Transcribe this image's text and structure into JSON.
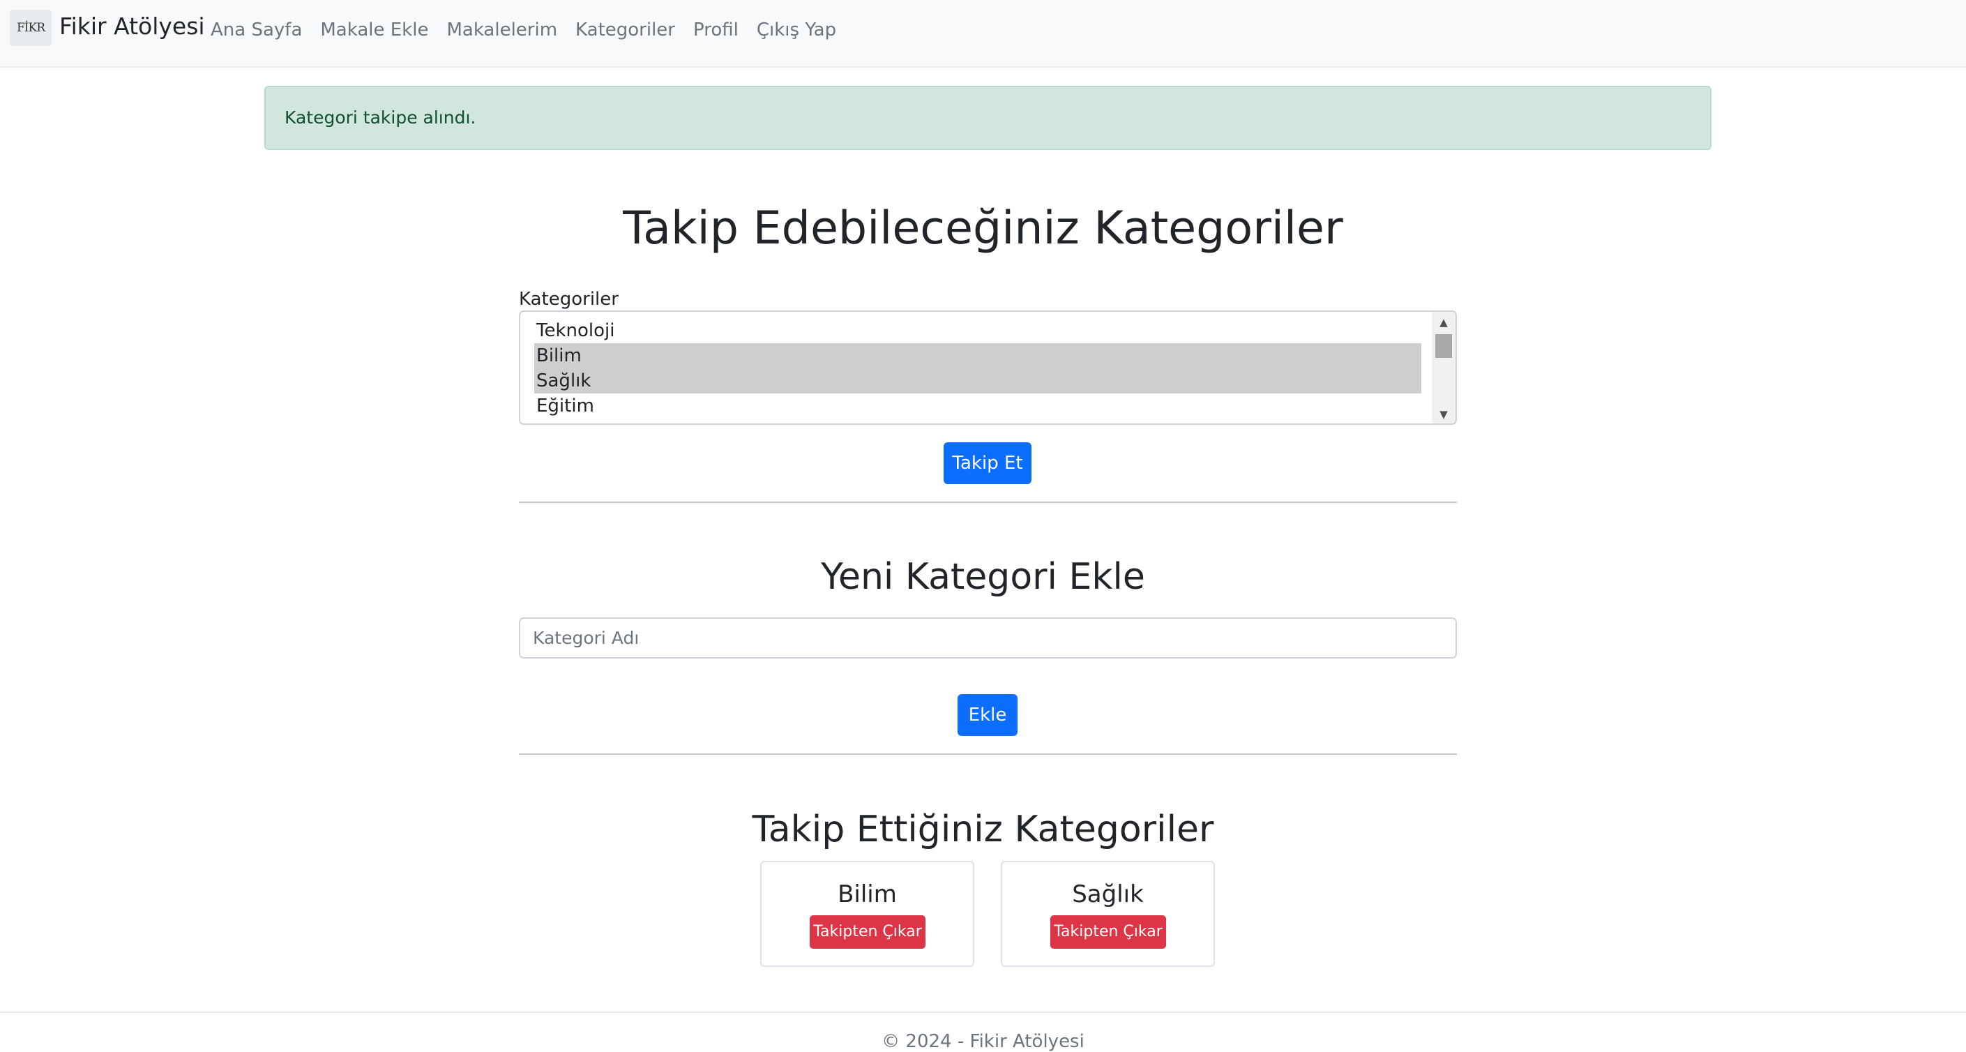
{
  "navbar": {
    "logo_text": "FİKR",
    "brand": "Fikir Atölyesi",
    "links": [
      "Ana Sayfa",
      "Makale Ekle",
      "Makalelerim",
      "Kategoriler",
      "Profil",
      "Çıkış Yap"
    ]
  },
  "alert": {
    "message": "Kategori takipe alındı."
  },
  "follow_section": {
    "title": "Takip Edebileceğiniz Kategoriler",
    "label": "Kategoriler",
    "options": [
      {
        "label": "Teknoloji",
        "selected": false
      },
      {
        "label": "Bilim",
        "selected": true
      },
      {
        "label": "Sağlık",
        "selected": true
      },
      {
        "label": "Eğitim",
        "selected": false
      }
    ],
    "button": "Takip Et"
  },
  "add_section": {
    "title": "Yeni Kategori Ekle",
    "input_placeholder": "Kategori Adı",
    "button": "Ekle"
  },
  "followed_section": {
    "title": "Takip Ettiğiniz Kategoriler",
    "cards": [
      {
        "name": "Bilim",
        "button": "Takipten Çıkar"
      },
      {
        "name": "Sağlık",
        "button": "Takipten Çıkar"
      }
    ]
  },
  "footer": {
    "text": "© 2024 - Fikir Atölyesi"
  },
  "colors": {
    "primary": "#0d6efd",
    "danger": "#dc3545",
    "alert_bg": "#d1e7dd",
    "alert_text": "#0f5132"
  }
}
